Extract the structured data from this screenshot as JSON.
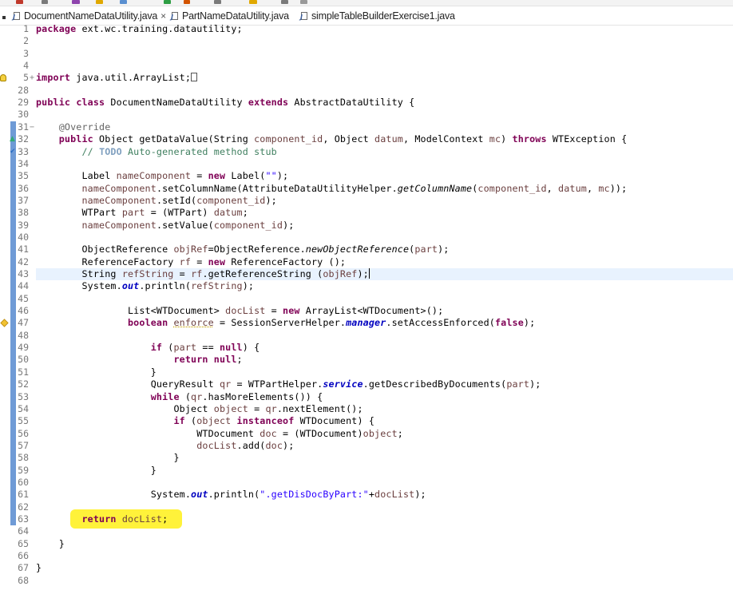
{
  "tabs": [
    {
      "label": "DocumentNameDataUtility.java",
      "active": true,
      "closable": true
    },
    {
      "label": "PartNameDataUtility.java",
      "active": false,
      "closable": false
    },
    {
      "label": "simpleTableBuilderExercise1.java",
      "active": false,
      "closable": false
    }
  ],
  "tab_close_glyph": "×",
  "colors": {
    "keyword": "#7f0055",
    "string": "#2a00ff",
    "comment": "#3f7f5f",
    "field": "#0000c0",
    "variable": "#6a3e3e",
    "highlight": "#fff23a",
    "current_line": "#e8f2fe"
  },
  "icons": [
    "java-file-icon",
    "warning-icon",
    "quick-fix-icon",
    "override-indicator-icon",
    "fold-expand-icon",
    "fold-collapse-icon"
  ],
  "editor": {
    "current_line_number": "43",
    "highlighted_line_number": "63",
    "lines": [
      {
        "n": "1",
        "tokens": [
          {
            "t": "package",
            "c": "kw"
          },
          {
            "t": " ext.wc.training.datautility;"
          }
        ]
      },
      {
        "n": "2",
        "tokens": []
      },
      {
        "n": "3",
        "tokens": []
      },
      {
        "n": "4",
        "tokens": []
      },
      {
        "n": "5",
        "fold": "+",
        "mark": "bulb",
        "tokens": [
          {
            "t": "import",
            "c": "kw"
          },
          {
            "t": " java.util.ArrayList;"
          },
          {
            "box": true
          }
        ]
      },
      {
        "n": "28",
        "tokens": []
      },
      {
        "n": "29",
        "tokens": [
          {
            "t": "public",
            "c": "kw"
          },
          {
            "t": " "
          },
          {
            "t": "class",
            "c": "kw"
          },
          {
            "t": " DocumentNameDataUtility "
          },
          {
            "t": "extends",
            "c": "kw"
          },
          {
            "t": " AbstractDataUtility {"
          }
        ]
      },
      {
        "n": "30",
        "tokens": []
      },
      {
        "n": "31",
        "fold": "−",
        "tokens": [
          {
            "t": "    "
          },
          {
            "t": "@Override",
            "c": "ann"
          }
        ]
      },
      {
        "n": "32",
        "mark": "override",
        "tokens": [
          {
            "t": "    "
          },
          {
            "t": "public",
            "c": "kw"
          },
          {
            "t": " Object getDataValue(String "
          },
          {
            "t": "component_id",
            "c": "var"
          },
          {
            "t": ", Object "
          },
          {
            "t": "datum",
            "c": "var"
          },
          {
            "t": ", ModelContext "
          },
          {
            "t": "mc",
            "c": "var"
          },
          {
            "t": ") "
          },
          {
            "t": "throws",
            "c": "kw"
          },
          {
            "t": " WTException {"
          }
        ]
      },
      {
        "n": "33",
        "mark": "todo",
        "tokens": [
          {
            "t": "        "
          },
          {
            "t": "// ",
            "c": "cmt"
          },
          {
            "t": "TODO",
            "c": "todo"
          },
          {
            "t": " Auto-generated method stub",
            "c": "cmt"
          }
        ]
      },
      {
        "n": "34",
        "tokens": []
      },
      {
        "n": "35",
        "tokens": [
          {
            "t": "        Label "
          },
          {
            "t": "nameComponent",
            "c": "var"
          },
          {
            "t": " = "
          },
          {
            "t": "new",
            "c": "kw"
          },
          {
            "t": " Label("
          },
          {
            "t": "\"\"",
            "c": "str"
          },
          {
            "t": ");"
          }
        ]
      },
      {
        "n": "36",
        "tokens": [
          {
            "t": "        "
          },
          {
            "t": "nameComponent",
            "c": "var"
          },
          {
            "t": ".setColumnName(AttributeDataUtilityHelper."
          },
          {
            "t": "getColumnName",
            "c": "ital"
          },
          {
            "t": "("
          },
          {
            "t": "component_id",
            "c": "var"
          },
          {
            "t": ", "
          },
          {
            "t": "datum",
            "c": "var"
          },
          {
            "t": ", "
          },
          {
            "t": "mc",
            "c": "var"
          },
          {
            "t": "));"
          }
        ]
      },
      {
        "n": "37",
        "tokens": [
          {
            "t": "        "
          },
          {
            "t": "nameComponent",
            "c": "var"
          },
          {
            "t": ".setId("
          },
          {
            "t": "component_id",
            "c": "var"
          },
          {
            "t": ");"
          }
        ]
      },
      {
        "n": "38",
        "tokens": [
          {
            "t": "        WTPart "
          },
          {
            "t": "part",
            "c": "var"
          },
          {
            "t": " = (WTPart) "
          },
          {
            "t": "datum",
            "c": "var"
          },
          {
            "t": ";"
          }
        ]
      },
      {
        "n": "39",
        "tokens": [
          {
            "t": "        "
          },
          {
            "t": "nameComponent",
            "c": "var"
          },
          {
            "t": ".setValue("
          },
          {
            "t": "component_id",
            "c": "var"
          },
          {
            "t": ");"
          }
        ]
      },
      {
        "n": "40",
        "tokens": []
      },
      {
        "n": "41",
        "tokens": [
          {
            "t": "        ObjectReference "
          },
          {
            "t": "objRef",
            "c": "var"
          },
          {
            "t": "=ObjectReference."
          },
          {
            "t": "newObjectReference",
            "c": "ital"
          },
          {
            "t": "("
          },
          {
            "t": "part",
            "c": "var"
          },
          {
            "t": ");"
          }
        ]
      },
      {
        "n": "42",
        "tokens": [
          {
            "t": "        ReferenceFactory "
          },
          {
            "t": "rf",
            "c": "var"
          },
          {
            "t": " = "
          },
          {
            "t": "new",
            "c": "kw"
          },
          {
            "t": " ReferenceFactory ();"
          }
        ]
      },
      {
        "n": "43",
        "cur": true,
        "tokens": [
          {
            "t": "        String "
          },
          {
            "t": "refString",
            "c": "var"
          },
          {
            "t": " = "
          },
          {
            "t": "rf",
            "c": "var"
          },
          {
            "t": ".getReferenceString ("
          },
          {
            "t": "objRef",
            "c": "var"
          },
          {
            "t": ");"
          },
          {
            "cursor": true
          }
        ]
      },
      {
        "n": "44",
        "tokens": [
          {
            "t": "        System."
          },
          {
            "t": "out",
            "c": "fld"
          },
          {
            "t": ".println("
          },
          {
            "t": "refString",
            "c": "var"
          },
          {
            "t": ");"
          }
        ]
      },
      {
        "n": "45",
        "tokens": []
      },
      {
        "n": "46",
        "tokens": [
          {
            "t": "                List<WTDocument> "
          },
          {
            "t": "docList",
            "c": "var"
          },
          {
            "t": " = "
          },
          {
            "t": "new",
            "c": "kw"
          },
          {
            "t": " ArrayList<WTDocument>();"
          }
        ]
      },
      {
        "n": "47",
        "mark": "warn",
        "tokens": [
          {
            "t": "                "
          },
          {
            "t": "boolean",
            "c": "kw"
          },
          {
            "t": " "
          },
          {
            "t": "enforce",
            "c": "var warnline"
          },
          {
            "t": " = SessionServerHelper."
          },
          {
            "t": "manager",
            "c": "fld"
          },
          {
            "t": ".setAccessEnforced("
          },
          {
            "t": "false",
            "c": "kw"
          },
          {
            "t": ");"
          }
        ]
      },
      {
        "n": "48",
        "tokens": []
      },
      {
        "n": "49",
        "tokens": [
          {
            "t": "                    "
          },
          {
            "t": "if",
            "c": "kw"
          },
          {
            "t": " ("
          },
          {
            "t": "part",
            "c": "var"
          },
          {
            "t": " == "
          },
          {
            "t": "null",
            "c": "kw"
          },
          {
            "t": ") {"
          }
        ]
      },
      {
        "n": "50",
        "tokens": [
          {
            "t": "                        "
          },
          {
            "t": "return",
            "c": "kw"
          },
          {
            "t": " "
          },
          {
            "t": "null",
            "c": "kw"
          },
          {
            "t": ";"
          }
        ]
      },
      {
        "n": "51",
        "tokens": [
          {
            "t": "                    }"
          }
        ]
      },
      {
        "n": "52",
        "tokens": [
          {
            "t": "                    QueryResult "
          },
          {
            "t": "qr",
            "c": "var"
          },
          {
            "t": " = WTPartHelper."
          },
          {
            "t": "service",
            "c": "fld"
          },
          {
            "t": ".getDescribedByDocuments("
          },
          {
            "t": "part",
            "c": "var"
          },
          {
            "t": ");"
          }
        ]
      },
      {
        "n": "53",
        "tokens": [
          {
            "t": "                    "
          },
          {
            "t": "while",
            "c": "kw"
          },
          {
            "t": " ("
          },
          {
            "t": "qr",
            "c": "var"
          },
          {
            "t": ".hasMoreElements()) {"
          }
        ]
      },
      {
        "n": "54",
        "tokens": [
          {
            "t": "                        Object "
          },
          {
            "t": "object",
            "c": "var"
          },
          {
            "t": " = "
          },
          {
            "t": "qr",
            "c": "var"
          },
          {
            "t": ".nextElement();"
          }
        ]
      },
      {
        "n": "55",
        "tokens": [
          {
            "t": "                        "
          },
          {
            "t": "if",
            "c": "kw"
          },
          {
            "t": " ("
          },
          {
            "t": "object",
            "c": "var"
          },
          {
            "t": " "
          },
          {
            "t": "instanceof",
            "c": "kw"
          },
          {
            "t": " WTDocument) {"
          }
        ]
      },
      {
        "n": "56",
        "tokens": [
          {
            "t": "                            WTDocument "
          },
          {
            "t": "doc",
            "c": "var"
          },
          {
            "t": " = (WTDocument)"
          },
          {
            "t": "object",
            "c": "var"
          },
          {
            "t": ";"
          }
        ]
      },
      {
        "n": "57",
        "tokens": [
          {
            "t": "                            "
          },
          {
            "t": "docList",
            "c": "var"
          },
          {
            "t": ".add("
          },
          {
            "t": "doc",
            "c": "var"
          },
          {
            "t": ");"
          }
        ]
      },
      {
        "n": "58",
        "tokens": [
          {
            "t": "                        }"
          }
        ]
      },
      {
        "n": "59",
        "tokens": [
          {
            "t": "                    }"
          }
        ]
      },
      {
        "n": "60",
        "tokens": []
      },
      {
        "n": "61",
        "tokens": [
          {
            "t": "                    System."
          },
          {
            "t": "out",
            "c": "fld"
          },
          {
            "t": ".println("
          },
          {
            "t": "\".getDisDocByPart:\"",
            "c": "str"
          },
          {
            "t": "+"
          },
          {
            "t": "docList",
            "c": "var"
          },
          {
            "t": ");"
          }
        ]
      },
      {
        "n": "62",
        "tokens": []
      },
      {
        "n": "63",
        "tokens": [
          {
            "t": "        "
          },
          {
            "t": "return",
            "c": "kw"
          },
          {
            "t": " "
          },
          {
            "t": "docList",
            "c": "var"
          },
          {
            "t": ";"
          }
        ]
      },
      {
        "n": "64",
        "tokens": []
      },
      {
        "n": "65",
        "tokens": [
          {
            "t": "    }"
          }
        ]
      },
      {
        "n": "66",
        "tokens": []
      },
      {
        "n": "67",
        "tokens": [
          {
            "t": "}"
          }
        ]
      },
      {
        "n": "68",
        "tokens": []
      }
    ]
  }
}
